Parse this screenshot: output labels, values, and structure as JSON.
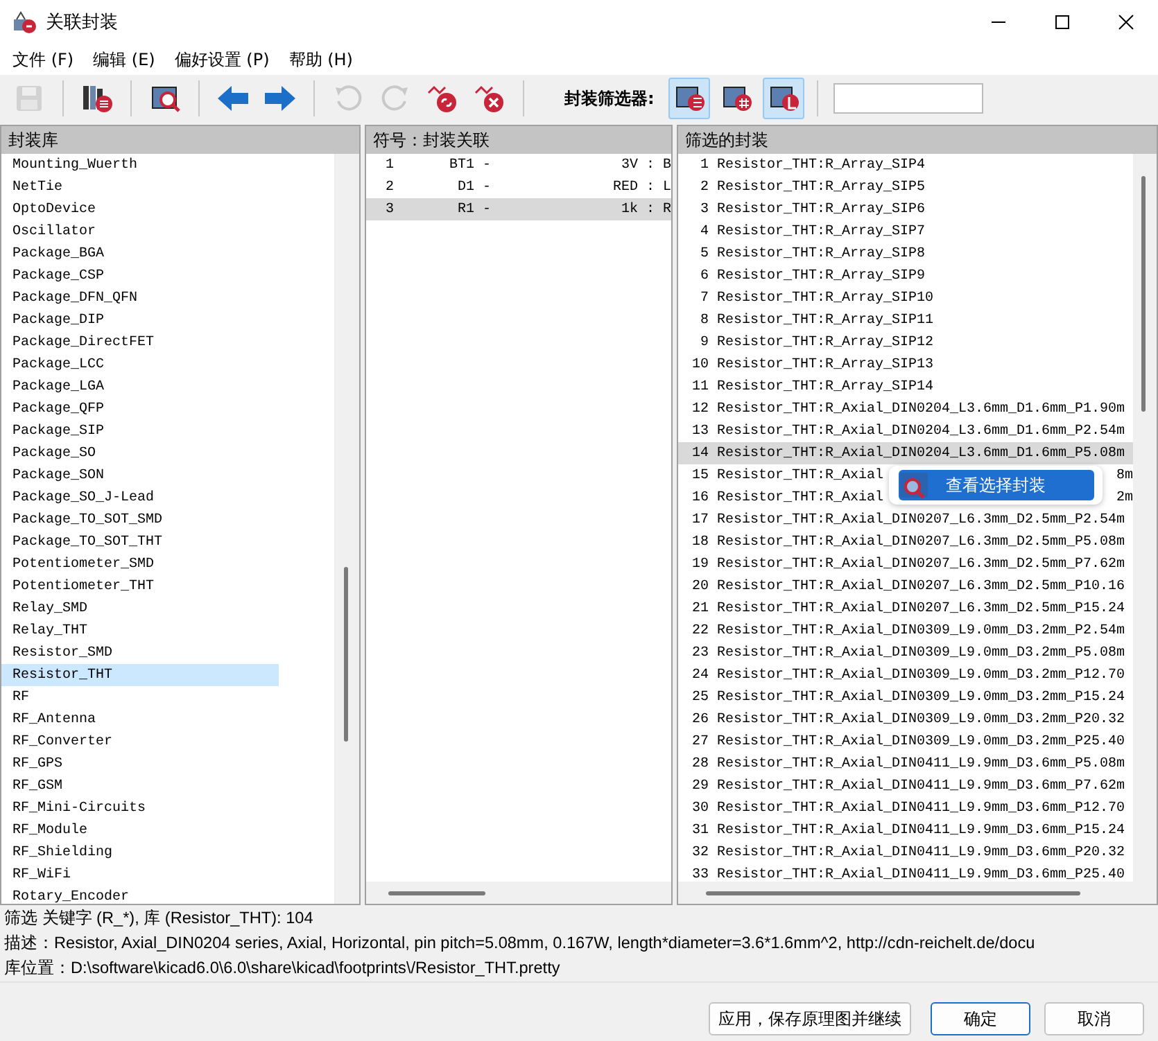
{
  "window": {
    "title": "关联封装"
  },
  "menu": [
    "文件 (F)",
    "编辑 (E)",
    "偏好设置 (P)",
    "帮助 (H)"
  ],
  "toolbar": {
    "buttons": [
      {
        "kind": "save",
        "disabled": true
      },
      {
        "kind": "library",
        "disabled": false
      },
      {
        "kind": "viewer",
        "disabled": false
      },
      {
        "kind": "previous",
        "disabled": false
      },
      {
        "kind": "next",
        "disabled": false
      },
      {
        "kind": "undo",
        "disabled": true
      },
      {
        "kind": "redo",
        "disabled": true
      },
      {
        "kind": "auto-link",
        "disabled": false
      },
      {
        "kind": "delete-links",
        "disabled": false
      }
    ],
    "filter_label": "封装筛选器:",
    "filters": [
      {
        "kind": "keywords",
        "selected": true
      },
      {
        "kind": "pin-count",
        "selected": false
      },
      {
        "kind": "library",
        "selected": true
      }
    ]
  },
  "libraries": {
    "title": "封装库",
    "items": [
      {
        "name": "Mounting_Wuerth",
        "selected": false
      },
      {
        "name": "NetTie",
        "selected": false
      },
      {
        "name": "OptoDevice",
        "selected": false
      },
      {
        "name": "Oscillator",
        "selected": false
      },
      {
        "name": "Package_BGA",
        "selected": false
      },
      {
        "name": "Package_CSP",
        "selected": false
      },
      {
        "name": "Package_DFN_QFN",
        "selected": false
      },
      {
        "name": "Package_DIP",
        "selected": false
      },
      {
        "name": "Package_DirectFET",
        "selected": false
      },
      {
        "name": "Package_LCC",
        "selected": false
      },
      {
        "name": "Package_LGA",
        "selected": false
      },
      {
        "name": "Package_QFP",
        "selected": false
      },
      {
        "name": "Package_SIP",
        "selected": false
      },
      {
        "name": "Package_SO",
        "selected": false
      },
      {
        "name": "Package_SON",
        "selected": false
      },
      {
        "name": "Package_SO_J-Lead",
        "selected": false
      },
      {
        "name": "Package_TO_SOT_SMD",
        "selected": false
      },
      {
        "name": "Package_TO_SOT_THT",
        "selected": false
      },
      {
        "name": "Potentiometer_SMD",
        "selected": false
      },
      {
        "name": "Potentiometer_THT",
        "selected": false
      },
      {
        "name": "Relay_SMD",
        "selected": false
      },
      {
        "name": "Relay_THT",
        "selected": false
      },
      {
        "name": "Resistor_SMD",
        "selected": false
      },
      {
        "name": "Resistor_THT",
        "selected": true
      },
      {
        "name": "RF",
        "selected": false
      },
      {
        "name": "RF_Antenna",
        "selected": false
      },
      {
        "name": "RF_Converter",
        "selected": false
      },
      {
        "name": "RF_GPS",
        "selected": false
      },
      {
        "name": "RF_GSM",
        "selected": false
      },
      {
        "name": "RF_Mini-Circuits",
        "selected": false
      },
      {
        "name": "RF_Module",
        "selected": false
      },
      {
        "name": "RF_Shielding",
        "selected": false
      },
      {
        "name": "RF_WiFi",
        "selected": false
      },
      {
        "name": "Rotary_Encoder",
        "selected": false
      }
    ]
  },
  "symbols": {
    "title": "符号：封装关联",
    "rows": [
      {
        "number": "1",
        "reference": "BT1 -",
        "value": "3V : B",
        "selected": false
      },
      {
        "number": "2",
        "reference": "D1 -",
        "value": "RED : L",
        "selected": false
      },
      {
        "number": "3",
        "reference": "R1 -",
        "value": "1k : R",
        "selected": true
      }
    ]
  },
  "footprints": {
    "title": "筛选的封装",
    "rows": [
      {
        "number": "1",
        "name": "Resistor_THT:R_Array_SIP4",
        "selected": false
      },
      {
        "number": "2",
        "name": "Resistor_THT:R_Array_SIP5",
        "selected": false
      },
      {
        "number": "3",
        "name": "Resistor_THT:R_Array_SIP6",
        "selected": false
      },
      {
        "number": "4",
        "name": "Resistor_THT:R_Array_SIP7",
        "selected": false
      },
      {
        "number": "5",
        "name": "Resistor_THT:R_Array_SIP8",
        "selected": false
      },
      {
        "number": "6",
        "name": "Resistor_THT:R_Array_SIP9",
        "selected": false
      },
      {
        "number": "7",
        "name": "Resistor_THT:R_Array_SIP10",
        "selected": false
      },
      {
        "number": "8",
        "name": "Resistor_THT:R_Array_SIP11",
        "selected": false
      },
      {
        "number": "9",
        "name": "Resistor_THT:R_Array_SIP12",
        "selected": false
      },
      {
        "number": "10",
        "name": "Resistor_THT:R_Array_SIP13",
        "selected": false
      },
      {
        "number": "11",
        "name": "Resistor_THT:R_Array_SIP14",
        "selected": false
      },
      {
        "number": "12",
        "name": "Resistor_THT:R_Axial_DIN0204_L3.6mm_D1.6mm_P1.90m",
        "selected": false
      },
      {
        "number": "13",
        "name": "Resistor_THT:R_Axial_DIN0204_L3.6mm_D1.6mm_P2.54m",
        "selected": false
      },
      {
        "number": "14",
        "name": "Resistor_THT:R_Axial_DIN0204_L3.6mm_D1.6mm_P5.08m",
        "selected": true
      },
      {
        "number": "15",
        "name": "Resistor_THT:R_Axial",
        "tail": "8m",
        "selected": false
      },
      {
        "number": "16",
        "name": "Resistor_THT:R_Axial",
        "tail": "2m",
        "selected": false
      },
      {
        "number": "17",
        "name": "Resistor_THT:R_Axial_DIN0207_L6.3mm_D2.5mm_P2.54m",
        "selected": false
      },
      {
        "number": "18",
        "name": "Resistor_THT:R_Axial_DIN0207_L6.3mm_D2.5mm_P5.08m",
        "selected": false
      },
      {
        "number": "19",
        "name": "Resistor_THT:R_Axial_DIN0207_L6.3mm_D2.5mm_P7.62m",
        "selected": false
      },
      {
        "number": "20",
        "name": "Resistor_THT:R_Axial_DIN0207_L6.3mm_D2.5mm_P10.16",
        "selected": false
      },
      {
        "number": "21",
        "name": "Resistor_THT:R_Axial_DIN0207_L6.3mm_D2.5mm_P15.24",
        "selected": false
      },
      {
        "number": "22",
        "name": "Resistor_THT:R_Axial_DIN0309_L9.0mm_D3.2mm_P2.54m",
        "selected": false
      },
      {
        "number": "23",
        "name": "Resistor_THT:R_Axial_DIN0309_L9.0mm_D3.2mm_P5.08m",
        "selected": false
      },
      {
        "number": "24",
        "name": "Resistor_THT:R_Axial_DIN0309_L9.0mm_D3.2mm_P12.70",
        "selected": false
      },
      {
        "number": "25",
        "name": "Resistor_THT:R_Axial_DIN0309_L9.0mm_D3.2mm_P15.24",
        "selected": false
      },
      {
        "number": "26",
        "name": "Resistor_THT:R_Axial_DIN0309_L9.0mm_D3.2mm_P20.32",
        "selected": false
      },
      {
        "number": "27",
        "name": "Resistor_THT:R_Axial_DIN0309_L9.0mm_D3.2mm_P25.40",
        "selected": false
      },
      {
        "number": "28",
        "name": "Resistor_THT:R_Axial_DIN0411_L9.9mm_D3.6mm_P5.08m",
        "selected": false
      },
      {
        "number": "29",
        "name": "Resistor_THT:R_Axial_DIN0411_L9.9mm_D3.6mm_P7.62m",
        "selected": false
      },
      {
        "number": "30",
        "name": "Resistor_THT:R_Axial_DIN0411_L9.9mm_D3.6mm_P12.70",
        "selected": false
      },
      {
        "number": "31",
        "name": "Resistor_THT:R_Axial_DIN0411_L9.9mm_D3.6mm_P15.24",
        "selected": false
      },
      {
        "number": "32",
        "name": "Resistor_THT:R_Axial_DIN0411_L9.9mm_D3.6mm_P20.32",
        "selected": false
      },
      {
        "number": "33",
        "name": "Resistor_THT:R_Axial_DIN0411_L9.9mm_D3.6mm_P25.40",
        "selected": false
      }
    ],
    "tooltip": "查看选择封装"
  },
  "status": {
    "filter": "筛选 关键字 (R_*), 库 (Resistor_THT): 104",
    "description": "描述：Resistor, Axial_DIN0204 series, Axial, Horizontal, pin pitch=5.08mm, 0.167W, length*diameter=3.6*1.6mm^2, http://cdn-reichelt.de/docu",
    "path": "库位置：D:\\software\\kicad6.0\\6.0\\share\\kicad\\footprints\\/Resistor_THT.pretty"
  },
  "buttons": [
    {
      "label": "应用，保存原理图并继续",
      "default": false
    },
    {
      "label": "确定",
      "default": true
    },
    {
      "label": "取消",
      "default": false
    }
  ]
}
